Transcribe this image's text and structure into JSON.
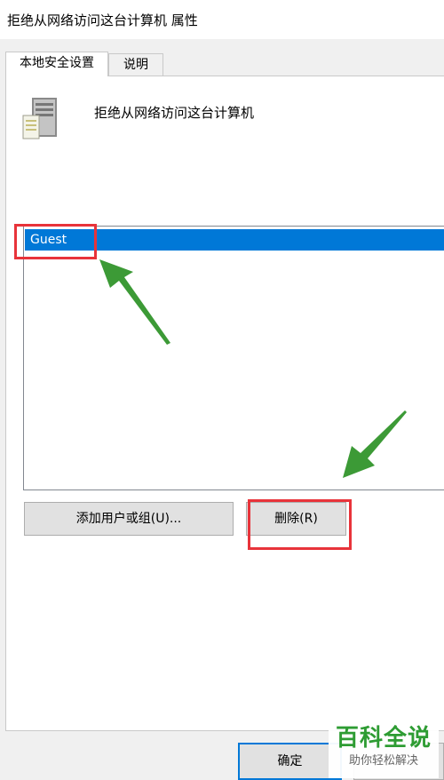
{
  "window": {
    "title": "拒绝从网络访问这台计算机 属性"
  },
  "tabs": [
    {
      "label": "本地安全设置",
      "active": true
    },
    {
      "label": "说明",
      "active": false
    }
  ],
  "policy": {
    "name": "拒绝从网络访问这台计算机",
    "icon": "server-icon"
  },
  "list": {
    "items": [
      {
        "label": "Guest",
        "selected": true
      }
    ],
    "selected_color": "#0078d7"
  },
  "buttons": {
    "add": "添加用户或组(U)...",
    "remove": "删除(R)",
    "ok": "确定"
  },
  "annotations": {
    "highlight_color": "#e8333a",
    "arrow_color": "#3c9a36"
  },
  "watermark": {
    "main": "百科全说",
    "sub": "助你轻松解决"
  }
}
